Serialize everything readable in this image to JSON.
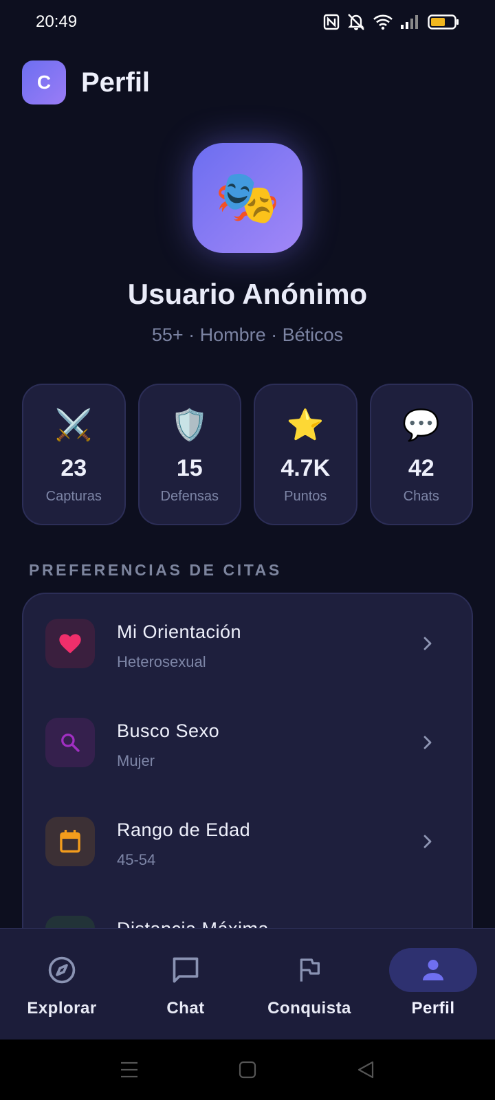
{
  "status_bar": {
    "time": "20:49",
    "battery_color": "#f0b61e"
  },
  "header": {
    "logo_letter": "C",
    "title": "Perfil"
  },
  "profile": {
    "avatar_emoji": "🎭",
    "name": "Usuario Anónimo",
    "meta": "55+ · Hombre · Béticos"
  },
  "stats": [
    {
      "icon": "⚔️",
      "icon_name": "crossed-swords-icon",
      "value": "23",
      "label": "Capturas"
    },
    {
      "icon": "🛡️",
      "icon_name": "shield-icon",
      "value": "15",
      "label": "Defensas"
    },
    {
      "icon": "⭐",
      "icon_name": "star-icon",
      "value": "4.7K",
      "label": "Puntos"
    },
    {
      "icon": "💬",
      "icon_name": "speech-bubble-icon",
      "value": "42",
      "label": "Chats"
    }
  ],
  "preferences": {
    "section_title": "PREFERENCIAS DE CITAS",
    "items": [
      {
        "title": "Mi Orientación",
        "value": "Heterosexual",
        "icon_name": "heart-icon",
        "accent": "#ef2f6b"
      },
      {
        "title": "Busco Sexo",
        "value": "Mujer",
        "icon_name": "search-icon",
        "accent": "#a12fc2"
      },
      {
        "title": "Rango de Edad",
        "value": "45-54",
        "icon_name": "calendar-icon",
        "accent": "#f39c1c"
      },
      {
        "title": "Distancia Máxima",
        "value": "",
        "icon_name": "location-icon",
        "accent": "#2fae8a"
      }
    ]
  },
  "bottom_nav": {
    "items": [
      {
        "label": "Explorar",
        "icon_name": "compass-icon",
        "active": false
      },
      {
        "label": "Chat",
        "icon_name": "chat-bubble-icon",
        "active": false
      },
      {
        "label": "Conquista",
        "icon_name": "flag-icon",
        "active": false
      },
      {
        "label": "Perfil",
        "icon_name": "person-icon",
        "active": true
      }
    ],
    "active_color": "#6f6ff0"
  }
}
